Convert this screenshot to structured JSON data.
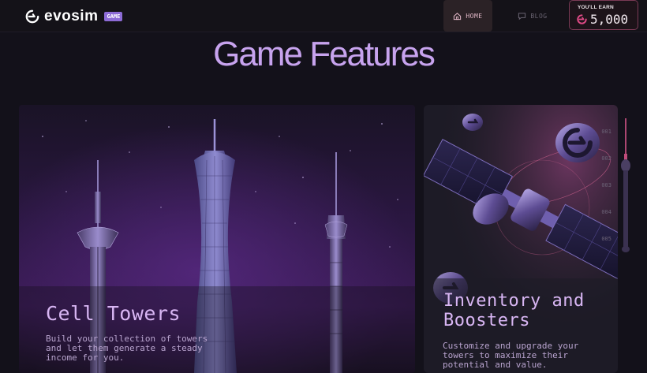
{
  "header": {
    "logo_text": "evosim",
    "logo_badge": "GAME",
    "nav": [
      {
        "label": "HOME",
        "icon": "home-icon",
        "active": true
      },
      {
        "label": "BLOG",
        "icon": "chat-icon",
        "active": false
      }
    ],
    "earn": {
      "label": "YOU'LL EARN",
      "value": "5,000",
      "icon": "evosim-coin-icon"
    }
  },
  "page": {
    "title": "Game Features"
  },
  "features": [
    {
      "title": "Cell Towers",
      "description": "Build your collection of towers and let them generate a steady income for you."
    },
    {
      "title": "Inventory and Boosters",
      "description": "Customize and upgrade your towers to maximize their potential and value.",
      "steps": [
        "001",
        "002",
        "003",
        "004",
        "005"
      ]
    }
  ],
  "colors": {
    "accent": "#c7a3ee",
    "earn_border": "#7a3a55",
    "background": "#13111a"
  }
}
